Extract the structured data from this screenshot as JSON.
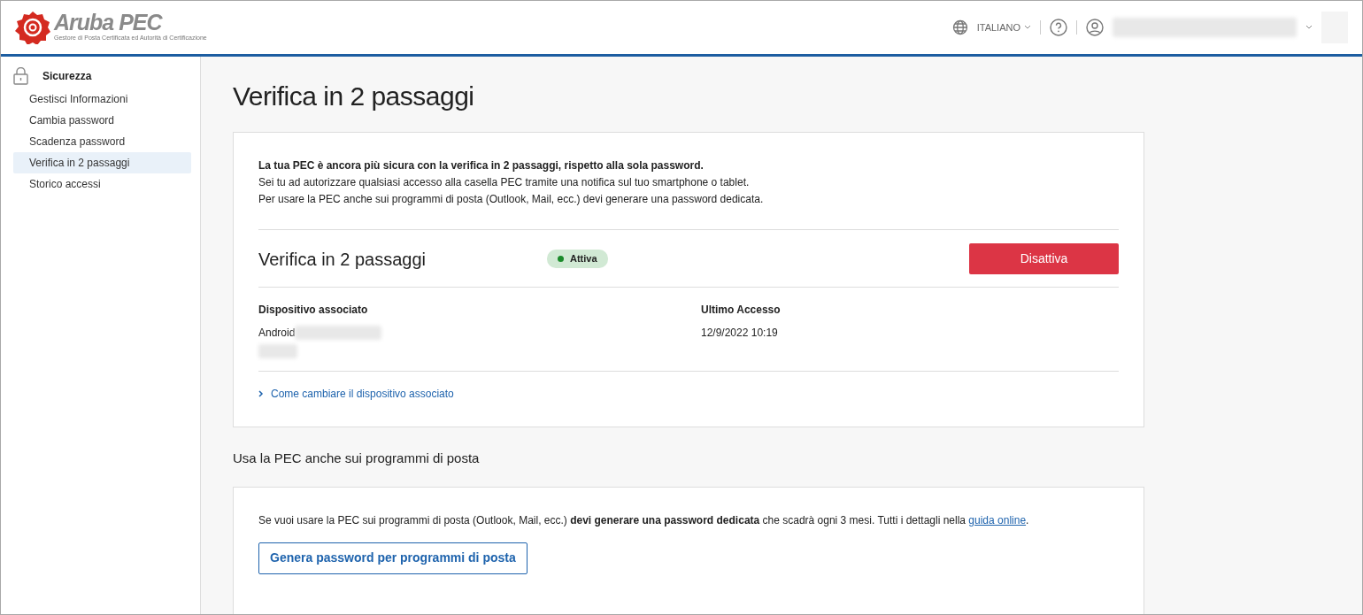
{
  "header": {
    "logo": {
      "name": "Aruba PEC",
      "tagline": "Gestore di Posta Certificata ed Autorità di Certificazione"
    },
    "language": "ITALIANO"
  },
  "sidebar": {
    "section": "Sicurezza",
    "items": [
      {
        "label": "Gestisci Informazioni",
        "selected": false
      },
      {
        "label": "Cambia password",
        "selected": false
      },
      {
        "label": "Scadenza password",
        "selected": false
      },
      {
        "label": "Verifica in 2 passaggi",
        "selected": true
      },
      {
        "label": "Storico accessi",
        "selected": false
      }
    ]
  },
  "page_title": "Verifica in 2 passaggi",
  "intro": [
    "**La tua PEC è ancora più sicura con la verifica in 2 passaggi, rispetto alla sola password.**",
    "Sei tu ad autorizzare qualsiasi accesso alla casella PEC tramite una notifica sul tuo smartphone o tablet.",
    "Per usare la PEC anche sui programmi di posta (Outlook, Mail, ecc.) devi generare una password dedicata."
  ],
  "verification": {
    "title": "Verifica in 2 passaggi",
    "status": "Attiva",
    "active": true,
    "button": "Disattiva",
    "device_label": "Dispositivo associato",
    "device": "Android",
    "last_access_label": "Ultimo Accesso",
    "last_access": "12/9/2022 10:19",
    "link": "Come cambiare il dispositivo associato"
  },
  "mail_programs": {
    "heading": "Usa la PEC anche sui programmi di posta",
    "text": "Se vuoi usare la PEC sui programmi di posta (Outlook, Mail, ecc.) **devi generare una password dedicata** che scadrà ogni 3 mesi. Tutti i dettagli nella ",
    "link": "guida online",
    "text_end": ".",
    "button": "Genera password per programmi di posta"
  }
}
